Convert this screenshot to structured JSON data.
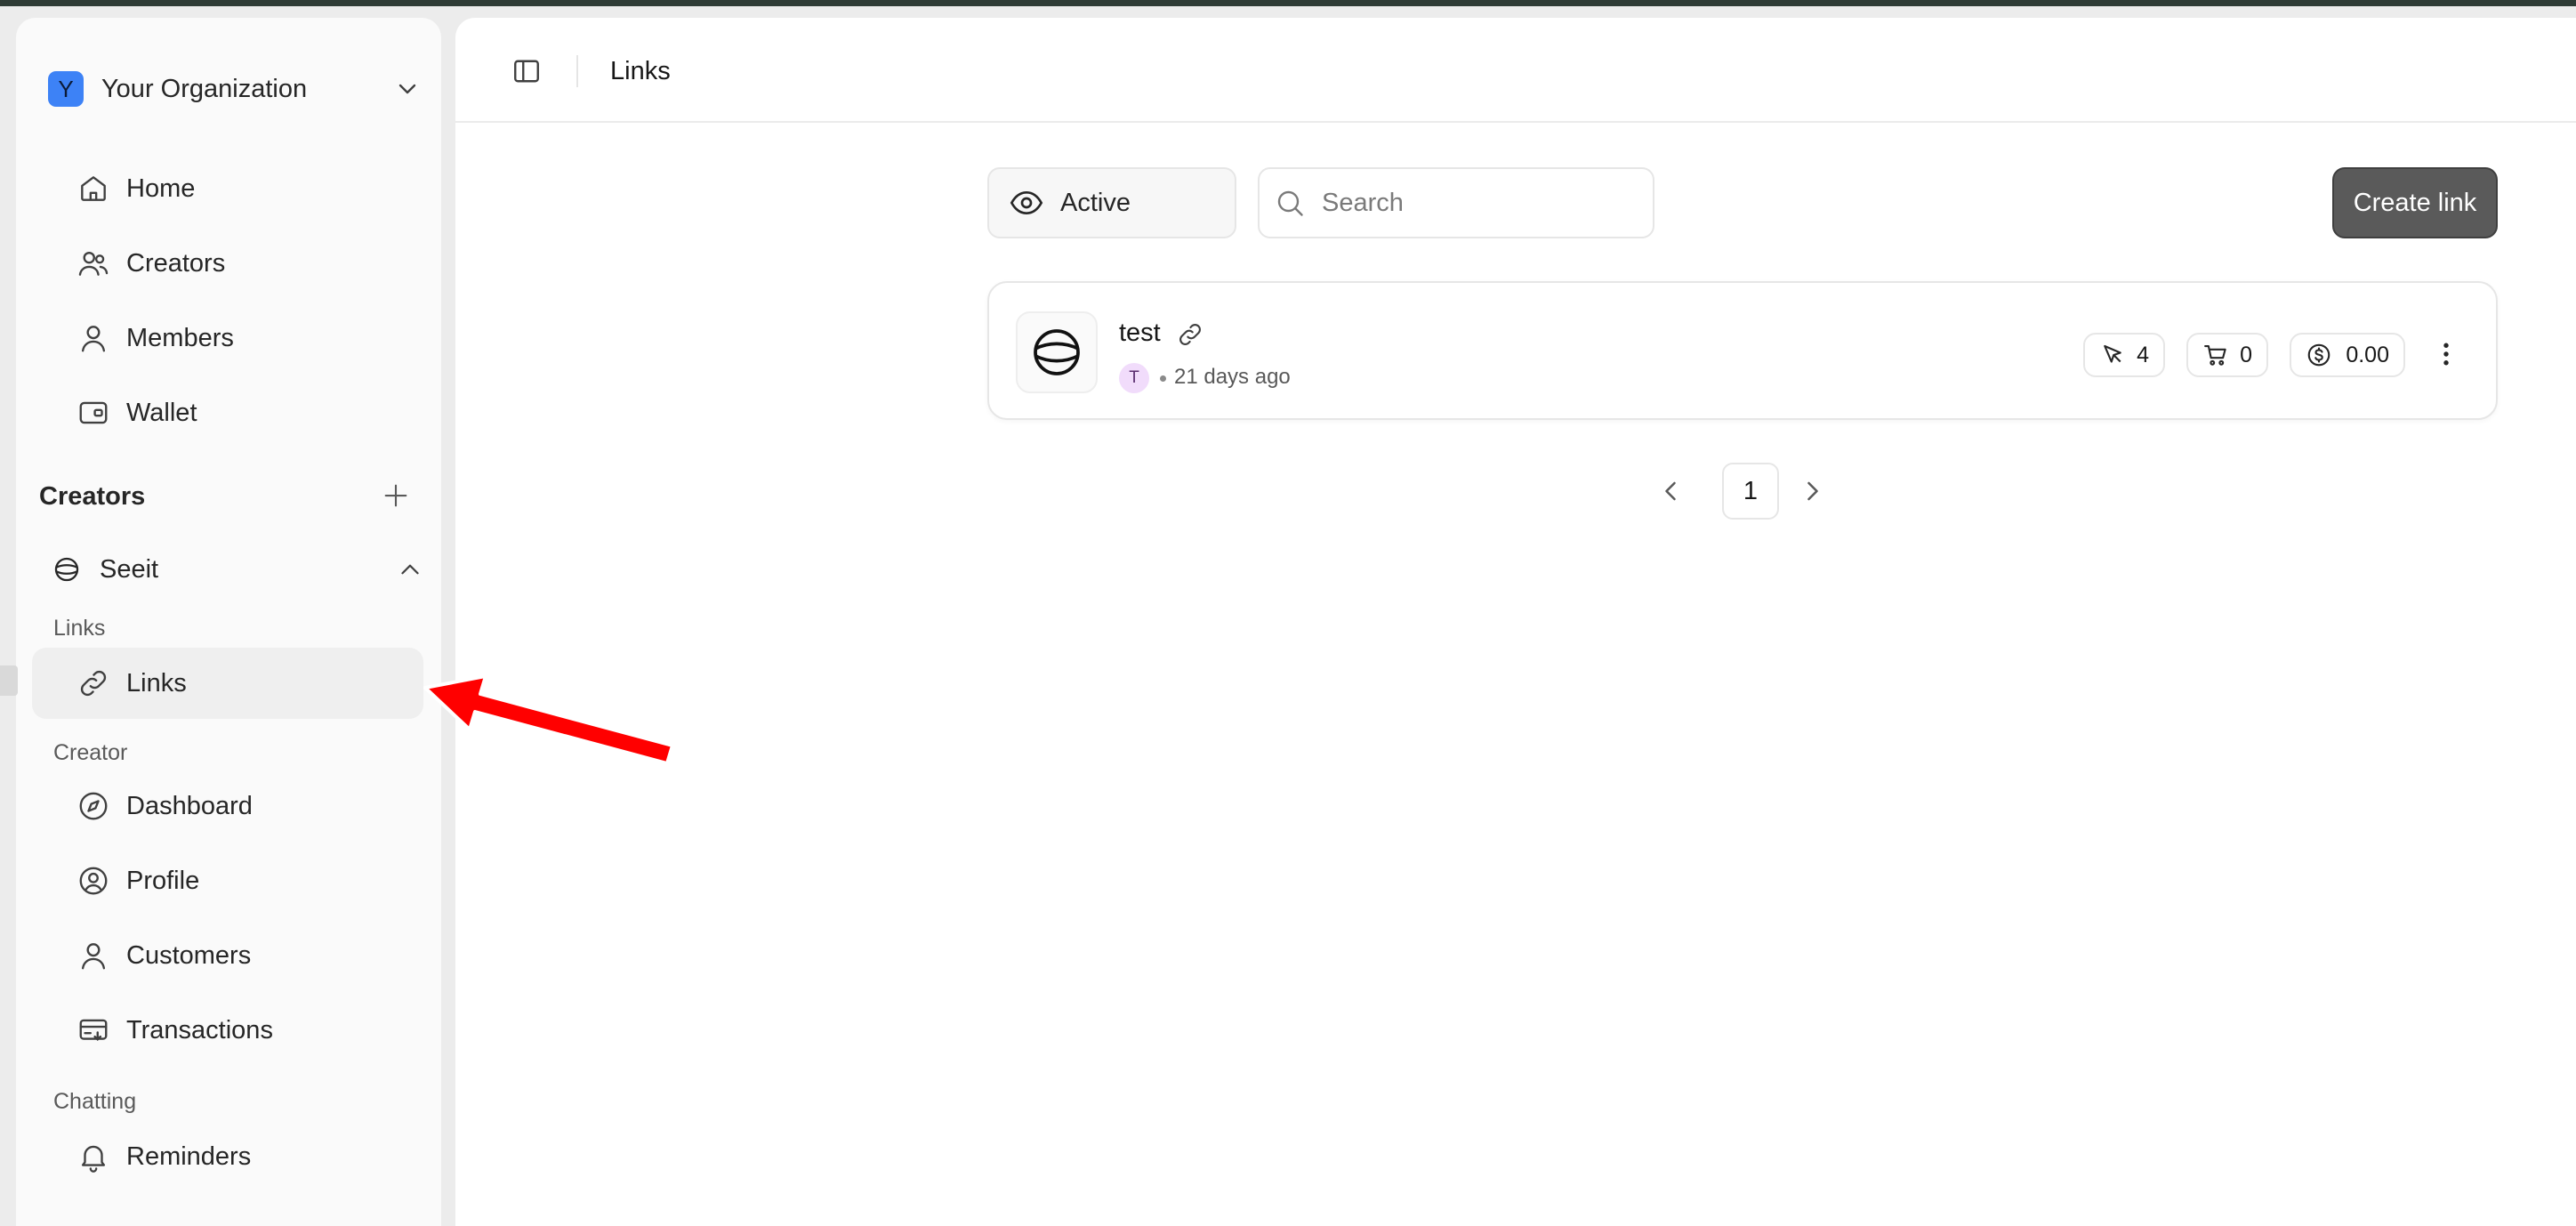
{
  "organization": {
    "initial": "Y",
    "name": "Your Organization"
  },
  "nav": {
    "home": "Home",
    "creators": "Creators",
    "members": "Members",
    "wallet": "Wallet"
  },
  "creators_section": {
    "title": "Creators",
    "creator_name": "Seeit",
    "groups": {
      "links": {
        "label": "Links",
        "items": [
          "Links"
        ]
      },
      "creator": {
        "label": "Creator",
        "items": [
          "Dashboard",
          "Profile",
          "Customers",
          "Transactions"
        ]
      },
      "chatting": {
        "label": "Chatting",
        "items": [
          "Reminders"
        ]
      }
    }
  },
  "header": {
    "title": "Links"
  },
  "toolbar": {
    "filter_label": "Active",
    "search_placeholder": "Search",
    "create_label": "Create link"
  },
  "links": [
    {
      "title": "test",
      "creator_initial": "T",
      "time_ago": "21 days ago",
      "clicks": "4",
      "orders": "0",
      "revenue": "0.00"
    }
  ],
  "pagination": {
    "current_page": "1"
  },
  "colors": {
    "org_avatar": "#3d82f6",
    "create_button": "#5a5a5a",
    "creator_badge": "#f1dcfb",
    "annotation_arrow": "#ff0000"
  }
}
